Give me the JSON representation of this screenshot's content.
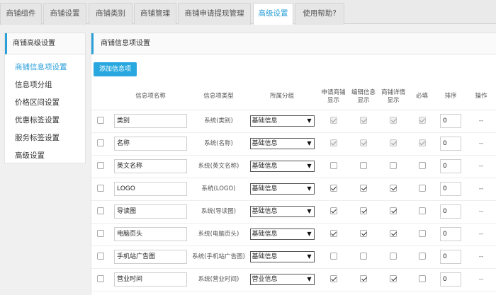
{
  "tabs": [
    {
      "label": "商铺组件",
      "active": false
    },
    {
      "label": "商铺设置",
      "active": false
    },
    {
      "label": "商铺类别",
      "active": false
    },
    {
      "label": "商铺管理",
      "active": false
    },
    {
      "label": "商铺申请提现管理",
      "active": false
    },
    {
      "label": "高级设置",
      "active": true
    },
    {
      "label": "使用帮助?",
      "active": false
    }
  ],
  "sidebar": {
    "title": "商铺高级设置",
    "items": [
      {
        "label": "商铺信息项设置",
        "active": true
      },
      {
        "label": "信息项分组",
        "active": false
      },
      {
        "label": "价格区间设置",
        "active": false
      },
      {
        "label": "优惠标签设置",
        "active": false
      },
      {
        "label": "服务标签设置",
        "active": false
      },
      {
        "label": "高级设置",
        "active": false
      }
    ]
  },
  "main": {
    "title": "商铺信息项设置",
    "add_button": "添加信息项",
    "headers": {
      "name": "信息项名称",
      "type": "信息项类型",
      "group": "所属分组",
      "apply_show": "申请商铺显示",
      "edit_show": "编辑信息显示",
      "detail_show": "商铺详情显示",
      "required": "必填",
      "sort": "排序",
      "action": "操作"
    },
    "rows": [
      {
        "name": "类别",
        "type": "系统(类别)",
        "group": "基础信息",
        "apply_show": true,
        "edit_show": true,
        "detail_show": true,
        "required": true,
        "locked": true,
        "sort": "0",
        "action": "--"
      },
      {
        "name": "名称",
        "type": "系统(名称)",
        "group": "基础信息",
        "apply_show": true,
        "edit_show": true,
        "detail_show": true,
        "required": true,
        "locked": true,
        "sort": "0",
        "action": "--"
      },
      {
        "name": "英文名称",
        "type": "系统(英文名称)",
        "group": "基础信息",
        "apply_show": false,
        "edit_show": false,
        "detail_show": false,
        "required": false,
        "locked": false,
        "sort": "0",
        "action": "--"
      },
      {
        "name": "LOGO",
        "type": "系统(LOGO)",
        "group": "基础信息",
        "apply_show": true,
        "edit_show": true,
        "detail_show": true,
        "required": false,
        "locked": false,
        "sort": "0",
        "action": "--"
      },
      {
        "name": "导读图",
        "type": "系统(导读图)",
        "group": "基础信息",
        "apply_show": true,
        "edit_show": true,
        "detail_show": true,
        "required": false,
        "locked": false,
        "sort": "0",
        "action": "--"
      },
      {
        "name": "电脑页头",
        "type": "系统(电脑页头)",
        "group": "基础信息",
        "apply_show": true,
        "edit_show": true,
        "detail_show": true,
        "required": false,
        "locked": false,
        "sort": "0",
        "action": "--"
      },
      {
        "name": "手机站广告图",
        "type": "系统(手机站广告图)",
        "group": "基础信息",
        "apply_show": false,
        "edit_show": false,
        "detail_show": false,
        "required": false,
        "locked": false,
        "sort": "0",
        "action": "--"
      },
      {
        "name": "营业时间",
        "type": "系统(营业时间)",
        "group": "营业信息",
        "apply_show": true,
        "edit_show": true,
        "detail_show": true,
        "required": false,
        "locked": false,
        "sort": "0",
        "action": "--"
      }
    ]
  },
  "icons": {
    "dropdown_caret": "▼"
  }
}
